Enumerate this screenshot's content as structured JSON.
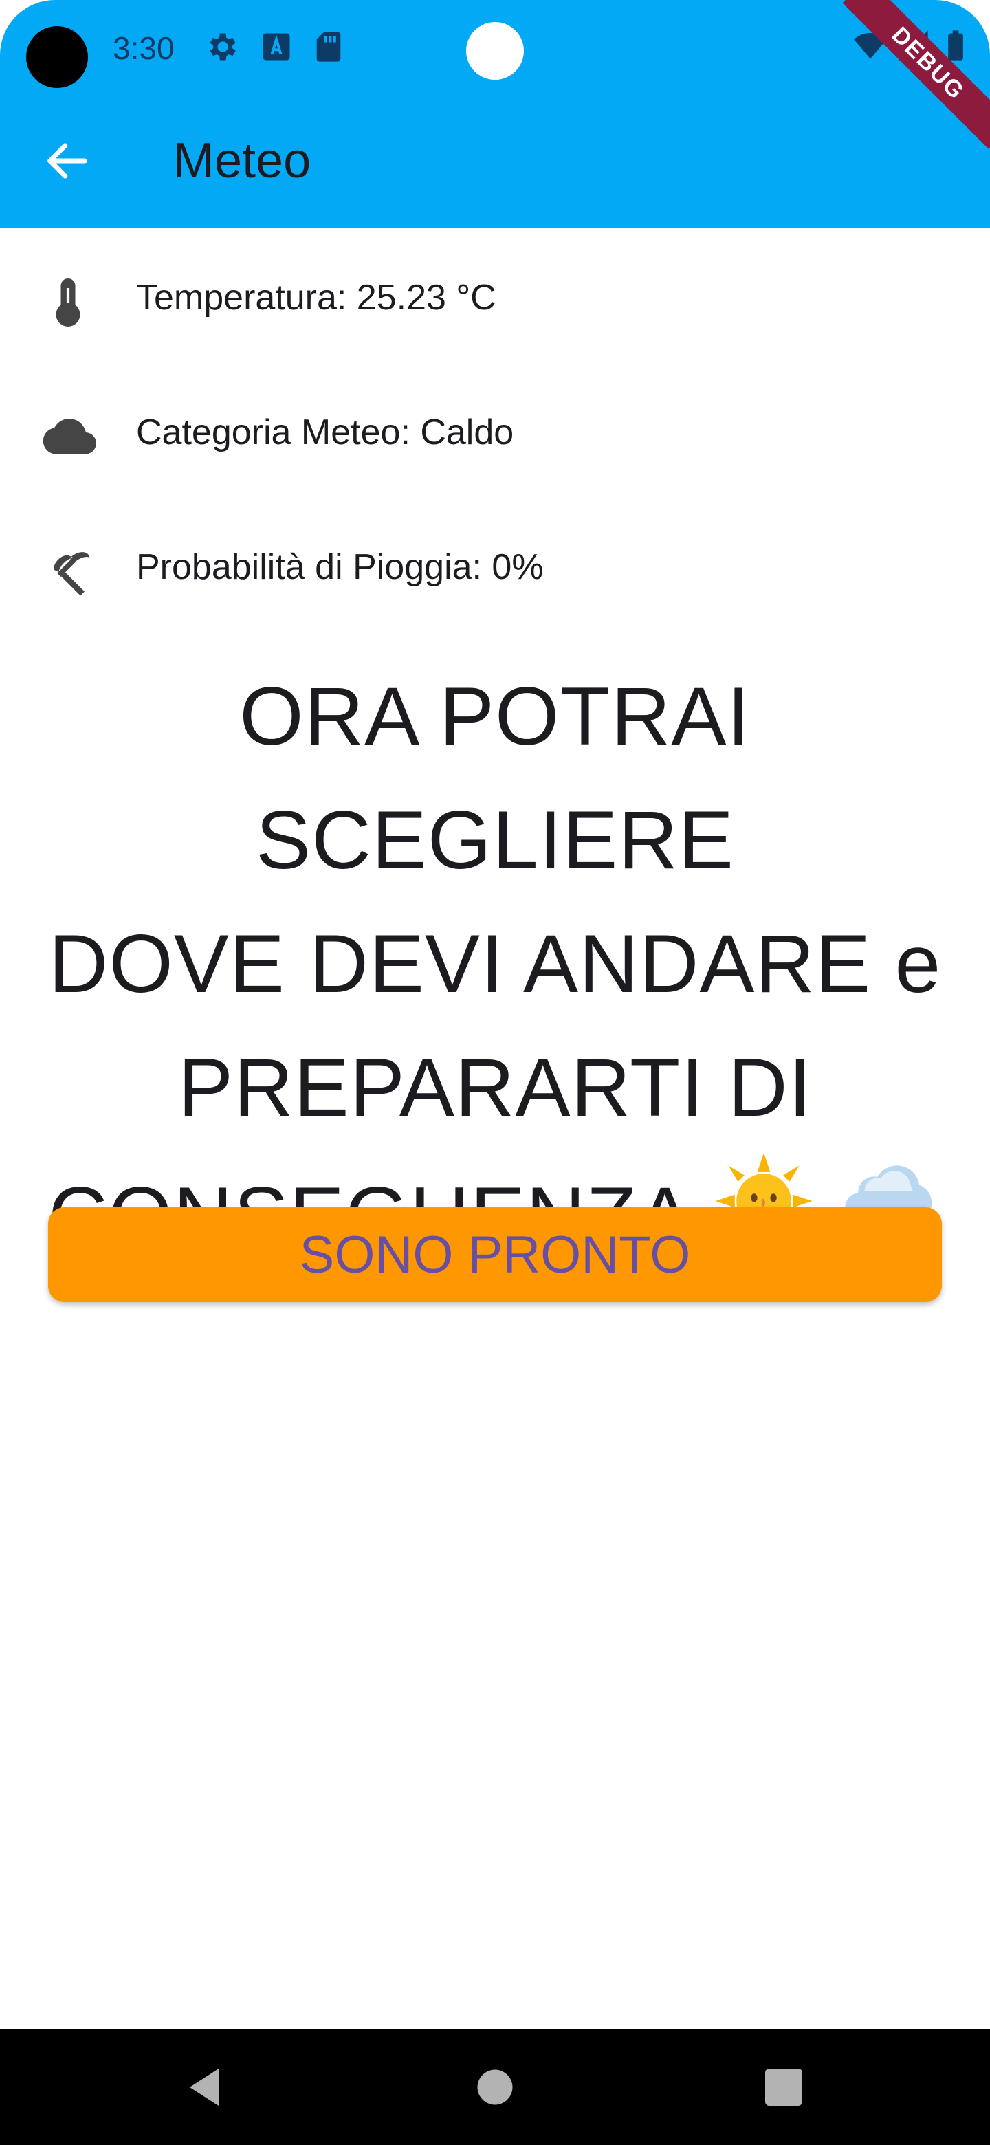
{
  "status_bar": {
    "time": "3:30",
    "icons": [
      "camera-cutout",
      "gear-icon",
      "a-box-icon",
      "sd-card-icon",
      "wifi-icon",
      "signal-icon",
      "battery-icon"
    ]
  },
  "debug_ribbon": "DEBUG",
  "appbar": {
    "title": "Meteo",
    "back_icon": "arrow-back-icon",
    "color": "#03a9f4"
  },
  "weather": {
    "temperature": "Temperatura: 25.23 °C",
    "category": "Categoria Meteo: Caldo",
    "rain_probability": "Probabilità di Pioggia: 0%"
  },
  "headline": {
    "line1": "ORA POTRAI SCEGLIERE",
    "line2": "DOVE DEVI ANDARE e",
    "line3": "PREPARARTI DI",
    "line4": "CONSEGUENZA",
    "emojis": [
      "sun-with-face-emoji",
      "cloud-with-rain-emoji"
    ]
  },
  "cta_button": {
    "label": "SONO PRONTO",
    "background": "#ff9800",
    "text_color": "#6750a4"
  },
  "nav_bar": {
    "buttons": [
      "back-triangle-icon",
      "home-circle-icon",
      "recents-square-icon"
    ]
  }
}
